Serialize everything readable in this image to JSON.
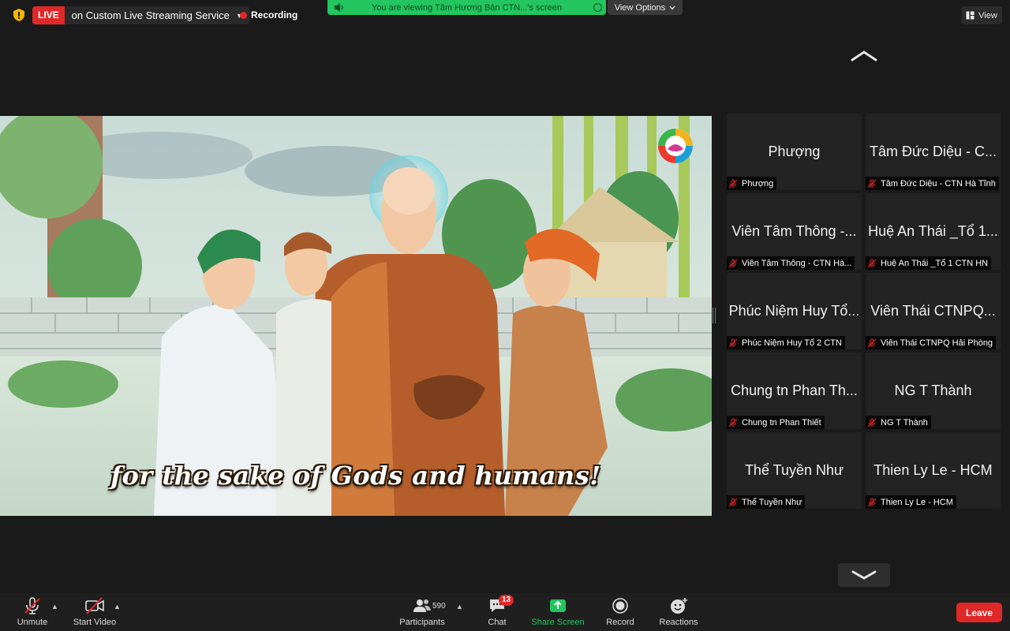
{
  "topbar": {
    "live_tag": "LIVE",
    "live_text": "on Custom Live Streaming Service",
    "recording": "Recording",
    "viewing": "You are viewing Tâm Hương Bản CTN...'s screen",
    "view_options": "View Options",
    "view": "View"
  },
  "screen": {
    "subtitle": "for the sake of Gods and humans!"
  },
  "gallery": {
    "tiles": [
      {
        "display": "Phượng",
        "name": "Phượng"
      },
      {
        "display": "Tâm Đức Diệu - C...",
        "name": "Tâm Đức Diệu - CTN Hà Tĩnh"
      },
      {
        "display": "Viên Tâm Thông -...",
        "name": "Viên Tâm Thông - CTN Hà..."
      },
      {
        "display": "Huệ An Thái _Tổ 1...",
        "name": "Huệ An Thái _Tổ 1 CTN HN"
      },
      {
        "display": "Phúc Niệm Huy Tổ...",
        "name": "Phúc Niệm Huy Tổ 2 CTN"
      },
      {
        "display": "Viên Thái CTNPQ...",
        "name": "Viên Thái CTNPQ Hải Phòng"
      },
      {
        "display": "Chung tn Phan Th...",
        "name": "Chung tn Phan Thiết"
      },
      {
        "display": "NG T Thành",
        "name": "NG T Thành"
      },
      {
        "display": "Thể Tuyền Như",
        "name": "Thể Tuyền Như"
      },
      {
        "display": "Thien Ly Le - HCM",
        "name": "Thien Ly Le - HCM"
      }
    ]
  },
  "toolbar": {
    "unmute": "Unmute",
    "start_video": "Start Video",
    "participants": "Participants",
    "participants_count": "590",
    "chat": "Chat",
    "chat_badge": "13",
    "share_screen": "Share Screen",
    "record": "Record",
    "reactions": "Reactions",
    "leave": "Leave"
  },
  "colors": {
    "live": "#e02828",
    "share_green": "#22c55e",
    "background": "#1a1a1a"
  }
}
